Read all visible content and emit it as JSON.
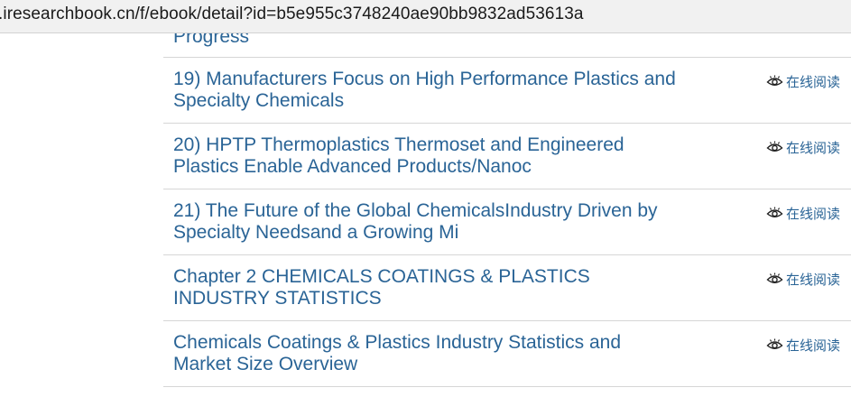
{
  "browser": {
    "url": ".iresearchbook.cn/f/ebook/detail?id=b5e955c3748240ae90bb9832ad53613a"
  },
  "list": {
    "partial_title": "Progress",
    "read_label": "在线阅读",
    "items": [
      {
        "title": "19) Manufacturers Focus on High Performance Plastics and Specialty Chemicals"
      },
      {
        "title": "20) HPTP Thermoplastics Thermoset and Engineered Plastics Enable Advanced Products/Nanoc"
      },
      {
        "title": "21) The Future of the Global ChemicalsIndustry Driven by Specialty Needsand a Growing Mi"
      },
      {
        "title": "Chapter 2 CHEMICALS COATINGS & PLASTICS INDUSTRY STATISTICS"
      },
      {
        "title": "Chemicals Coatings & Plastics Industry Statistics and Market Size Overview"
      }
    ]
  },
  "colors": {
    "link": "#2a6496",
    "divider": "#d6d6d6",
    "urlbar_bg": "#f1f1f1"
  },
  "icons": {
    "read": "eye-icon"
  }
}
